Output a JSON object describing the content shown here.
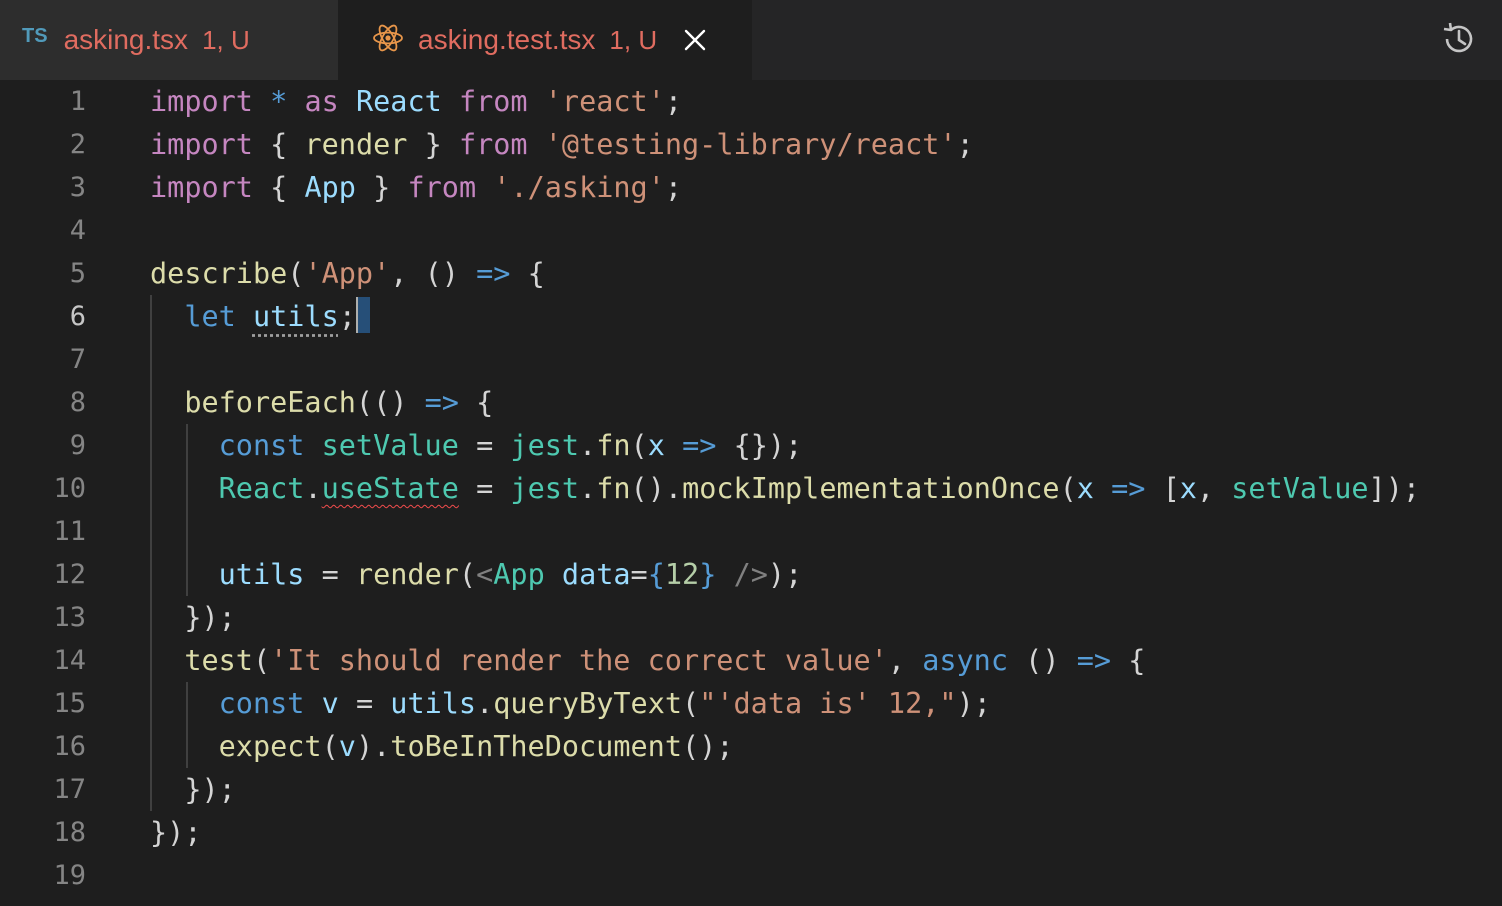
{
  "tabs": [
    {
      "icon": "TS",
      "name": "asking.tsx",
      "badge": "1, U"
    },
    {
      "icon": "react-icon",
      "name": "asking.test.tsx",
      "badge": "1, U",
      "active": true
    }
  ],
  "editor": {
    "line_numbers": [
      "1",
      "2",
      "3",
      "4",
      "5",
      "6",
      "7",
      "8",
      "9",
      "10",
      "11",
      "12",
      "13",
      "14",
      "15",
      "16",
      "17",
      "18",
      "19"
    ],
    "active_line": "6",
    "lines": [
      "import * as React from 'react';",
      "import { render } from '@testing-library/react';",
      "import { App } from './asking';",
      "",
      "describe('App', () => {",
      "  let utils;",
      "",
      "  beforeEach(() => {",
      "    const setValue = jest.fn(x => {});",
      "    React.useState = jest.fn().mockImplementationOnce(x => [x, setValue]);",
      "",
      "    utils = render(<App data={12} />);",
      "  });",
      "  test('It should render the correct value', async () => {",
      "    const v = utils.queryByText(\"'data is' 12,\");",
      "    expect(v).toBeInTheDocument();",
      "  });",
      "});",
      ""
    ]
  },
  "colors": {
    "keyword_control": "#c586c0",
    "keyword": "#569cd6",
    "string": "#ce9178",
    "variable": "#9cdcfe",
    "function": "#dcdcaa",
    "type": "#4ec9b0",
    "tab_modified": "#e06c60"
  }
}
